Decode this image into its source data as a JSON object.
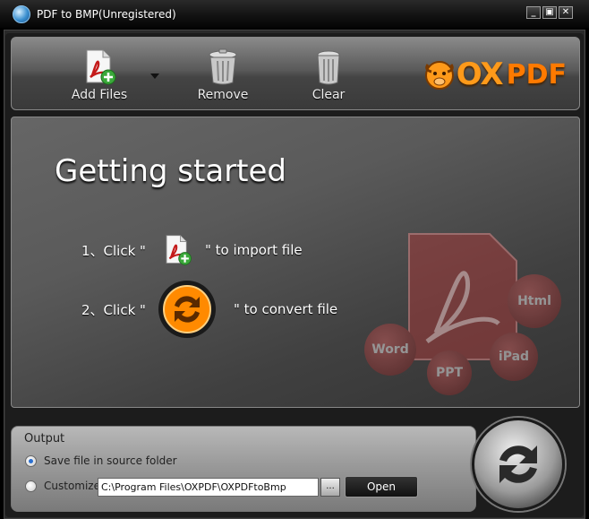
{
  "window": {
    "title": "PDF to BMP(Unregistered)",
    "buttons": [
      "_",
      "▣",
      "✕"
    ]
  },
  "toolbar": {
    "add_files_label": "Add Files",
    "remove_label": "Remove",
    "clear_label": "Clear"
  },
  "logo": {
    "ox": "OX",
    "pdf": "PDF"
  },
  "main": {
    "title": "Getting started",
    "step1_prefix": "1、Click \"",
    "step1_suffix": "\" to import file",
    "step2_prefix": "2、Click \"",
    "step2_suffix": "\" to convert file",
    "decor_labels": [
      "Html",
      "Word",
      "PPT",
      "iPad"
    ]
  },
  "output": {
    "title": "Output",
    "save_in_source_label": "Save file in source folder",
    "customize_label": "Customize",
    "path_value": "C:\\Program Files\\OXPDF\\OXPDFtoBmp",
    "browse_label": "...",
    "open_label": "Open"
  },
  "colors": {
    "accent_orange": "#ff8a00",
    "pdf_red": "#c41a1a"
  }
}
